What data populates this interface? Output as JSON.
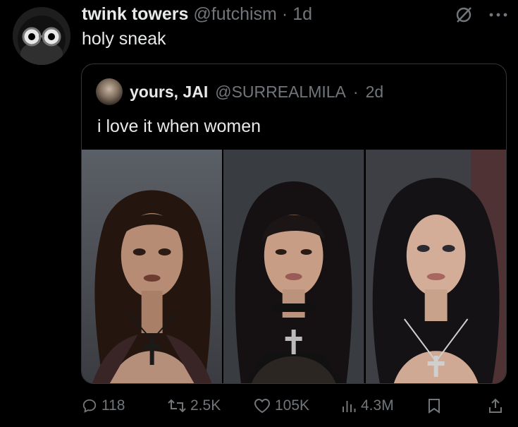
{
  "post": {
    "author_name": "twink towers",
    "author_handle": "@futchism",
    "separator": "·",
    "time": "1d",
    "text": "holy sneak"
  },
  "quoted_post": {
    "author_name": "yours, JAI",
    "author_handle": "@SURREALMILA",
    "separator": "·",
    "time": "2d",
    "text": "i love it when women"
  },
  "media": {
    "count": 3,
    "icons": [
      "photo-left",
      "photo-center",
      "photo-right"
    ]
  },
  "actions": {
    "replies": "118",
    "reposts": "2.5K",
    "likes": "105K",
    "views": "4.3M"
  },
  "icons": {
    "top": [
      "grok-icon",
      "more-icon"
    ],
    "bottom": [
      "reply-icon",
      "repost-icon",
      "like-icon",
      "views-icon",
      "bookmark-icon",
      "share-icon"
    ]
  },
  "colors": {
    "background": "#000000",
    "text": "#e7e9ea",
    "secondary": "#71767b",
    "border": "#333639"
  }
}
